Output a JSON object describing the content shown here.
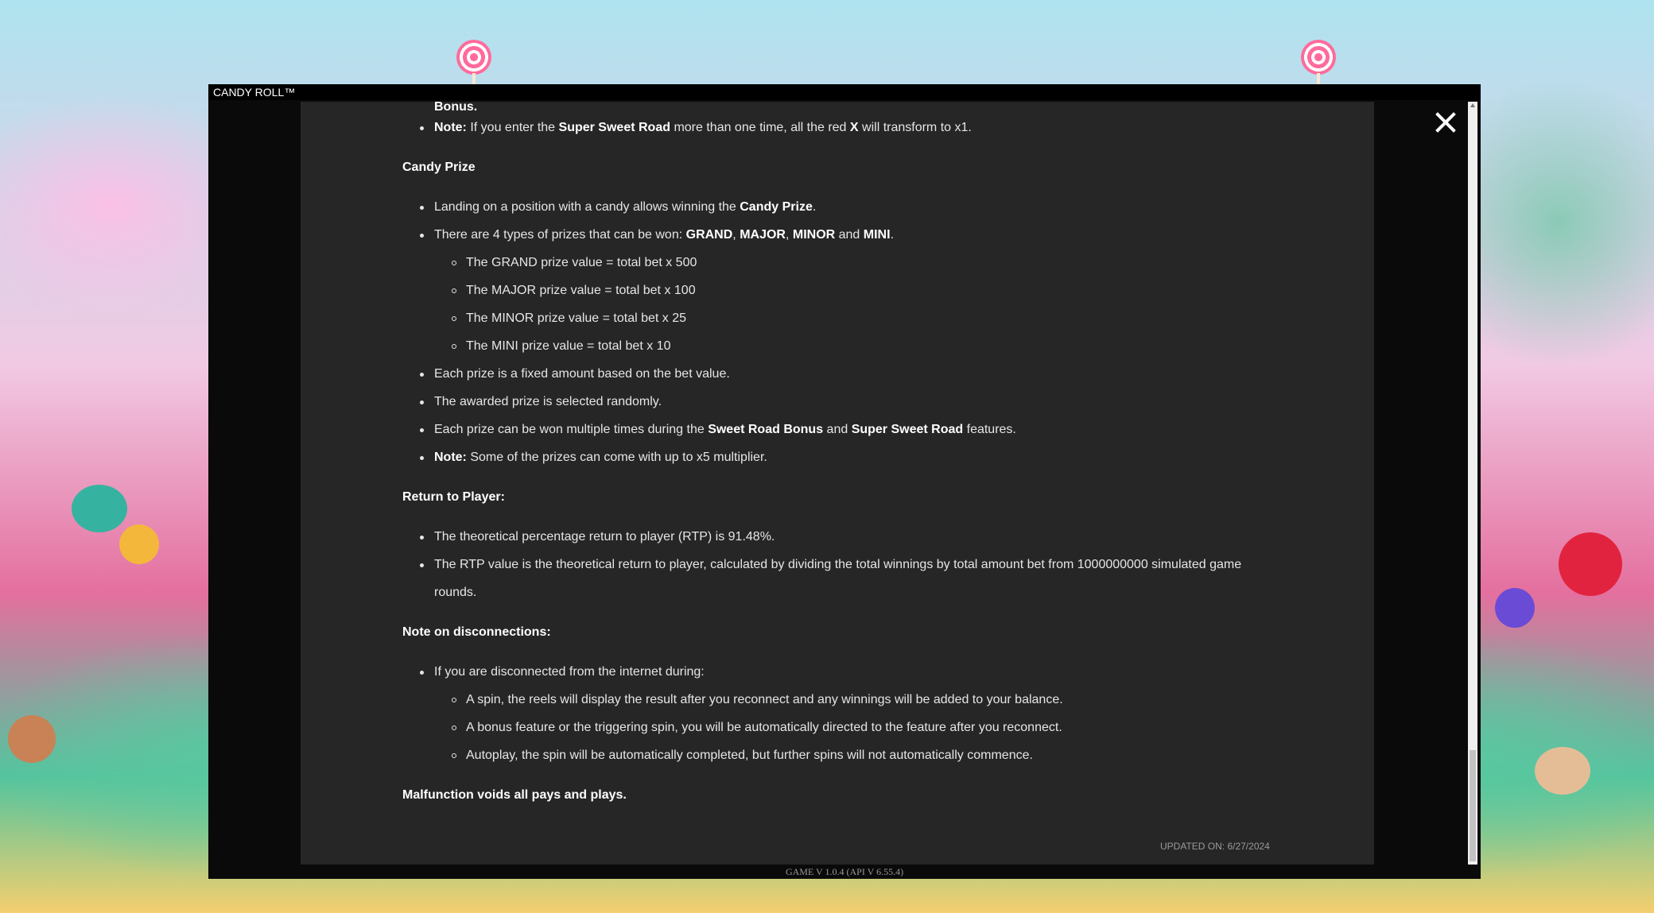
{
  "window": {
    "title": "CANDY ROLL™"
  },
  "content": {
    "lines": [
      {
        "parts": [
          {
            "t": "Bonus.",
            "b": true
          }
        ]
      },
      {
        "parts": [
          {
            "t": "Note:",
            "b": true
          },
          {
            "t": " If you enter the "
          },
          {
            "t": "Super Sweet Road",
            "b": true
          },
          {
            "t": " more than one time, all the red "
          },
          {
            "t": "X",
            "b": true
          },
          {
            "t": " will transform to x1."
          }
        ]
      },
      {
        "parts": [
          {
            "t": "Candy Prize",
            "b": true
          }
        ]
      },
      {
        "parts": [
          {
            "t": "Landing on a position with a candy allows winning the "
          },
          {
            "t": "Candy Prize",
            "b": true
          },
          {
            "t": "."
          }
        ]
      },
      {
        "parts": [
          {
            "t": "There are 4 types of prizes that can be won: "
          },
          {
            "t": "GRAND",
            "b": true
          },
          {
            "t": ", "
          },
          {
            "t": "MAJOR",
            "b": true
          },
          {
            "t": ", "
          },
          {
            "t": "MINOR",
            "b": true
          },
          {
            "t": " and "
          },
          {
            "t": "MINI",
            "b": true
          },
          {
            "t": "."
          }
        ]
      },
      {
        "parts": [
          {
            "t": "The GRAND prize value = total bet x 500"
          }
        ]
      },
      {
        "parts": [
          {
            "t": "The MAJOR prize value = total bet x 100"
          }
        ]
      },
      {
        "parts": [
          {
            "t": "The MINOR prize value = total bet x 25"
          }
        ]
      },
      {
        "parts": [
          {
            "t": "The MINI prize value = total bet x 10"
          }
        ]
      },
      {
        "parts": [
          {
            "t": "Each prize is a fixed amount based on the bet value."
          }
        ]
      },
      {
        "parts": [
          {
            "t": "The awarded prize is selected randomly."
          }
        ]
      },
      {
        "parts": [
          {
            "t": "Each prize can be won multiple times during the "
          },
          {
            "t": "Sweet Road Bonus",
            "b": true
          },
          {
            "t": " and "
          },
          {
            "t": "Super Sweet Road",
            "b": true
          },
          {
            "t": " features."
          }
        ]
      },
      {
        "parts": [
          {
            "t": "Note:",
            "b": true
          },
          {
            "t": " Some of the prizes can come with up to x5 multiplier."
          }
        ]
      },
      {
        "parts": [
          {
            "t": "Return to Player:",
            "b": true
          }
        ]
      },
      {
        "parts": [
          {
            "t": "The theoretical percentage return to player (RTP) is 91.48%."
          }
        ]
      },
      {
        "parts": [
          {
            "t": "The RTP value is the theoretical return to player, calculated by dividing the total winnings by total amount bet from 1000000000 simulated game"
          }
        ]
      },
      {
        "parts": [
          {
            "t": "rounds."
          }
        ]
      },
      {
        "parts": [
          {
            "t": "Note on disconnections:",
            "b": true
          }
        ]
      },
      {
        "parts": [
          {
            "t": "If you are disconnected from the internet during:"
          }
        ]
      },
      {
        "parts": [
          {
            "t": "A spin, the reels will display the result after you reconnect and any winnings will be added to your balance."
          }
        ]
      },
      {
        "parts": [
          {
            "t": "A bonus feature or the triggering spin, you will be automatically directed to the feature after you reconnect."
          }
        ]
      },
      {
        "parts": [
          {
            "t": "Autoplay, the spin will be automatically completed, but further spins will not automatically commence."
          }
        ]
      },
      {
        "parts": [
          {
            "t": "Malfunction voids all pays and plays.",
            "b": true
          }
        ]
      }
    ],
    "updated": "UPDATED ON:  6/27/2024"
  },
  "footer": {
    "version": "GAME V 1.0.4 (API V 6.55.4)"
  },
  "icons": {
    "close": "close-icon"
  },
  "colors": {
    "panel": "#262626",
    "modal": "#0a0a0a",
    "text": "#e6e6e6"
  }
}
